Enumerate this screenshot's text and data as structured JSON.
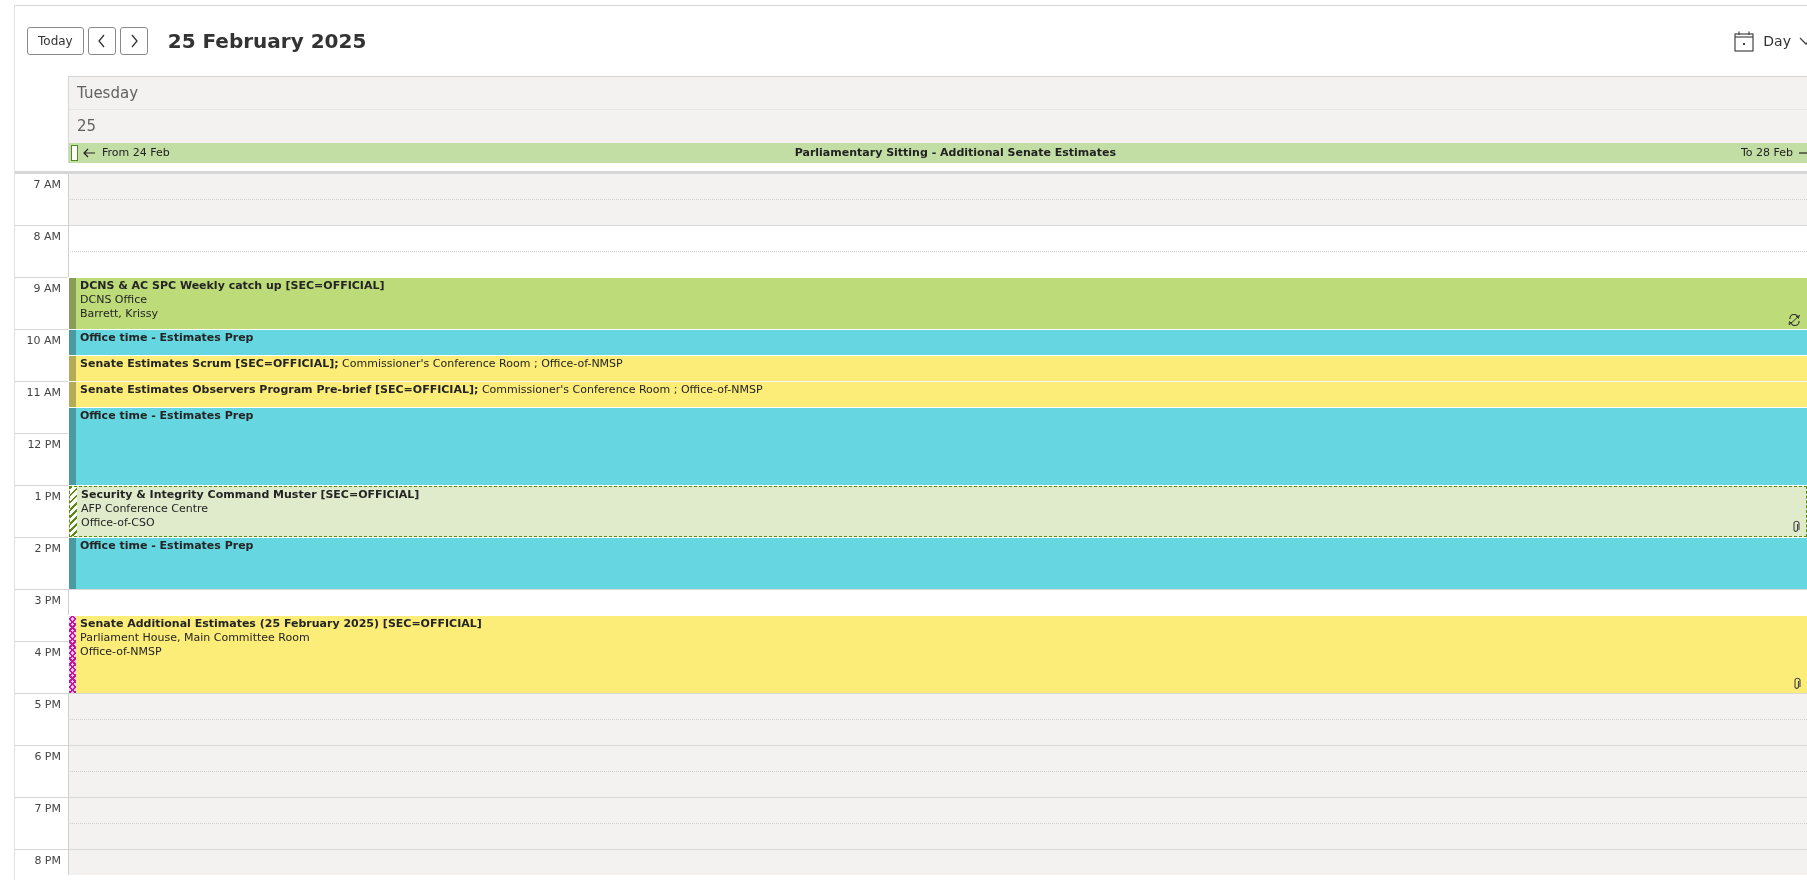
{
  "toolbar": {
    "today": "Today",
    "title": "25 February 2025",
    "view": "Day"
  },
  "day_header": {
    "weekday": "Tuesday",
    "date": "25"
  },
  "all_day_event": {
    "from": "From 24 Feb",
    "title": "Parliamentary Sitting - Additional Senate Estimates",
    "to": "To 28 Feb",
    "color": "#c2dea5"
  },
  "hours": [
    "7 AM",
    "8 AM",
    "9 AM",
    "10 AM",
    "11 AM",
    "12 PM",
    "1 PM",
    "2 PM",
    "3 PM",
    "4 PM",
    "5 PM",
    "6 PM",
    "7 PM",
    "8 PM"
  ],
  "events": [
    {
      "kind": "block",
      "title": "DCNS & AC SPC Weekly catch up [SEC=OFFICIAL]",
      "lines": [
        "DCNS Office",
        "Barrett, Krissy"
      ],
      "tentative": false,
      "working_elsewhere": false,
      "color": "#bddb78",
      "recurrence_exception": true,
      "attachment": false
    },
    {
      "kind": "block",
      "title": "Office time - Estimates Prep",
      "tentative": false,
      "working_elsewhere": false,
      "color": "#66d6e0",
      "recurrence_exception": false,
      "attachment": false
    },
    {
      "kind": "inline",
      "title": "**Senate Estimates Scrum [SEC=OFFICIAL];** Commissioner's Conference Room ; Office-of-NMSP",
      "tentative": false,
      "working_elsewhere": false,
      "color": "#fced78",
      "recurrence_exception": false,
      "attachment": false
    },
    {
      "kind": "inline",
      "title": "**Senate Estimates Observers Program Pre-brief [SEC=OFFICIAL];** Commissioner's Conference Room ; Office-of-NMSP",
      "tentative": false,
      "working_elsewhere": false,
      "color": "#fced78",
      "recurrence_exception": false,
      "attachment": false
    },
    {
      "kind": "block",
      "title": "Office time - Estimates Prep",
      "tentative": false,
      "working_elsewhere": false,
      "color": "#66d6e0",
      "recurrence_exception": false,
      "attachment": false
    },
    {
      "kind": "block",
      "title": "Security & Integrity Command Muster [SEC=OFFICIAL]",
      "lines": [
        "AFP Conference Centre",
        "Office-of-CSO"
      ],
      "tentative": true,
      "working_elsewhere": false,
      "color": "#e0ebcb",
      "recurrence_exception": false,
      "attachment": true
    },
    {
      "kind": "block",
      "title": "Office time - Estimates Prep",
      "tentative": false,
      "working_elsewhere": false,
      "color": "#66d6e0",
      "recurrence_exception": false,
      "attachment": false
    },
    {
      "kind": "block",
      "title": "Senate Additional Estimates (25 February 2025) [SEC=OFFICIAL]",
      "lines": [
        "Parliament House, Main Committee Room",
        "Office-of-NMSP"
      ],
      "tentative": false,
      "working_elsewhere": true,
      "color": "#fced78",
      "recurrence_exception": false,
      "attachment": true
    }
  ]
}
